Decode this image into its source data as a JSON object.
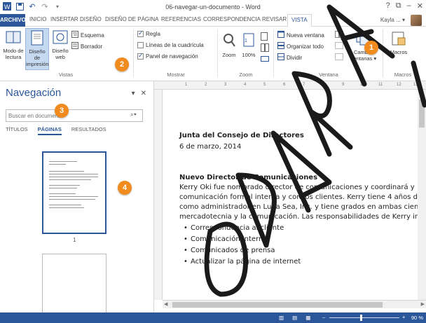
{
  "window": {
    "title": "06-navegar-un-documento - Word",
    "controls": [
      "?",
      "⧉",
      "–",
      "✕"
    ]
  },
  "ribbon_tabs": {
    "file": "ARCHIVO",
    "items": [
      "INICIO",
      "INSERTAR",
      "DISEÑO",
      "DISEÑO DE PÁGINA",
      "REFERENCIAS",
      "CORRESPONDENCIA",
      "REVISAR",
      "VISTA"
    ],
    "active": "VISTA",
    "user": "Kayla ... ▾"
  },
  "ribbon": {
    "vistas": {
      "modo_lectura": [
        "Modo de",
        "lectura"
      ],
      "diseno_impresion": [
        "Diseño de",
        "impresión"
      ],
      "diseno_web": [
        "Diseño",
        "web"
      ],
      "esquema": "Esquema",
      "borrador": "Borrador",
      "group_label": "Vistas"
    },
    "mostrar": {
      "regla": "Regla",
      "lineas_cuadricula": "Líneas de la cuadrícula",
      "panel_navegacion": "Panel de navegación",
      "regla_checked": true,
      "lineas_checked": false,
      "panel_checked": true,
      "group_label": "Mostrar"
    },
    "zoom": {
      "zoom_label": "Zoom",
      "hundred_label": "100%",
      "group_label": "Zoom"
    },
    "ventana": {
      "nueva_ventana": "Nueva ventana",
      "organizar_todo": "Organizar todo",
      "dividir": "Dividir",
      "cambiar_ventanas": [
        "Cambiar",
        "ventanas ▾"
      ],
      "group_label": "Ventana"
    },
    "macros": {
      "label": "Macros",
      "group_label": "Macros"
    }
  },
  "callouts": [
    "1",
    "2",
    "3",
    "4"
  ],
  "navigation": {
    "title": "Navegación",
    "search_placeholder": "Buscar en documento",
    "tabs": [
      "TÍTULOS",
      "PÁGINAS",
      "RESULTADOS"
    ],
    "active_tab": "PÁGINAS",
    "page_number": "1"
  },
  "ruler": {
    "ticks": [
      "1",
      "2",
      "3",
      "4",
      "5",
      "6",
      "7",
      "8",
      "9",
      "10",
      "11",
      "12",
      "13"
    ]
  },
  "document": {
    "heading1": "Junta del Consejo de Directores",
    "date": "6 de marzo, 2014",
    "heading2": "Nuevo Director de Comunicaciones",
    "paragraph": [
      "Kerry Oki fue nombrado director de comunicaciones y coordinará y",
      "comunicación formal interna y con los clientes. Kerry tiene 4 años d",
      "como administrador en Luna Sea, Inc. y tiene grados en ambas cienc",
      "mercadotecnia y la comunicación. Las responsabilidades de Kerry in"
    ],
    "bullets": [
      "Correspondencia al cliente",
      "Comunicación interna",
      "Comunicados de prensa",
      "Actualizar la página de internet"
    ]
  },
  "status_bar": {
    "zoom": "90 %",
    "zoom_level": 0.45
  },
  "watermark": {
    "text": "BORRADOR",
    "color": "#1a1a1a"
  },
  "colors": {
    "accent": "#2b579a",
    "callout": "#f28b1e"
  }
}
